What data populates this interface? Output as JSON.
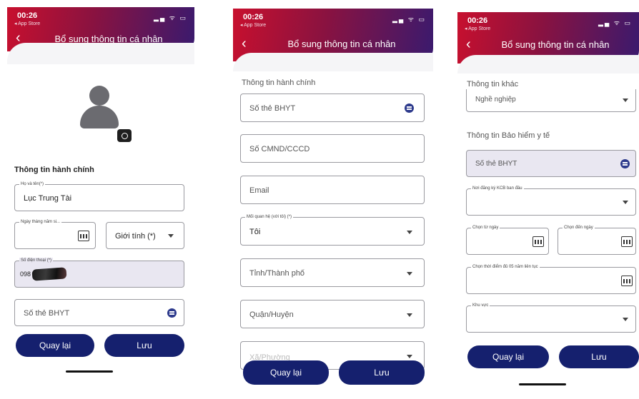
{
  "screens": [
    {
      "time": "00:26",
      "store": "◂ App Store",
      "status": "▂▄ ᯤ ▭",
      "title": "Bổ sung thông tin cá nhân",
      "section": "Thông tin hành chính",
      "name": {
        "label": "Họ và tên(*)",
        "value": "Lục Trung Tài"
      },
      "dob": {
        "label": "Ngày tháng năm si..."
      },
      "gender": {
        "value": "Giới tính (*)"
      },
      "phone": {
        "label": "Số điện thoại (*)",
        "value": "098"
      },
      "bhyt": {
        "placeholder": "Số thẻ BHYT"
      },
      "back_label": "Quay lại",
      "save_label": "Lưu"
    },
    {
      "time": "00:26",
      "store": "◂ App Store",
      "status": "▂▄ ᯤ ▭",
      "title": "Bổ sung thông tin cá nhân",
      "section": "Thông tin hành chính",
      "bhyt": {
        "placeholder": "Số thẻ BHYT"
      },
      "cmnd": {
        "placeholder": "Số CMND/CCCD"
      },
      "email": {
        "placeholder": "Email"
      },
      "relation": {
        "label": "Mối quan hệ (với tôi) (*)",
        "value": "Tôi"
      },
      "province": {
        "placeholder": "Tỉnh/Thành phố"
      },
      "district": {
        "placeholder": "Quận/Huyện"
      },
      "ward": {
        "placeholder": "Xã/Phường"
      },
      "back_label": "Quay lại",
      "save_label": "Lưu"
    },
    {
      "time": "00:26",
      "store": "◂ App Store",
      "status": "▂▄ ᯤ ▭",
      "title": "Bổ sung thông tin cá nhân",
      "section_other": "Thông tin khác",
      "job": {
        "placeholder": "Nghề nghiệp"
      },
      "section_insurance": "Thông tin Bảo hiểm y tế",
      "bhyt": {
        "placeholder": "Số thẻ BHYT"
      },
      "kcb": {
        "label": "Nơi đăng ký KCB ban đầu"
      },
      "from": {
        "label": "Chọn từ ngày"
      },
      "to": {
        "label": "Chọn đến ngày"
      },
      "five_years": {
        "label": "Chọn thời điểm đủ 05 năm liên tục"
      },
      "region": {
        "label": "Khu vực"
      },
      "back_label": "Quay lại",
      "save_label": "Lưu"
    }
  ]
}
